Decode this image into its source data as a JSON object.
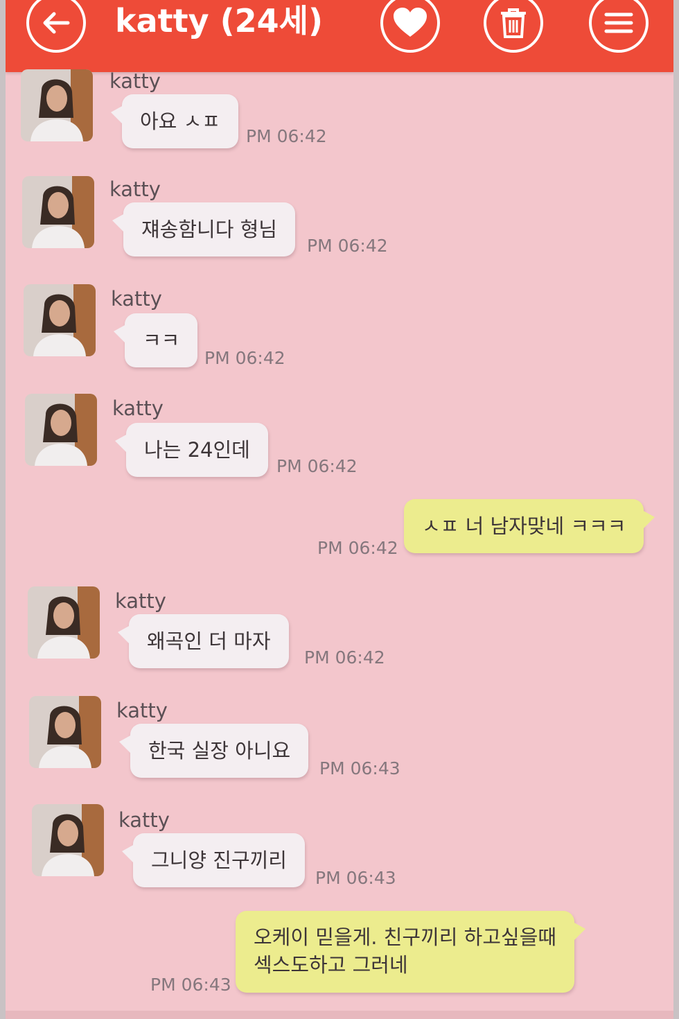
{
  "header": {
    "title": "katty (24세)",
    "icons": [
      "back-arrow-icon",
      "heart-icon",
      "trash-icon",
      "menu-icon"
    ],
    "bar_color": "#ee4b38"
  },
  "chat": {
    "background": "#f3c6cc",
    "incoming_bubble_color": "#f4eef1",
    "outgoing_bubble_color": "#ecec8e",
    "messages": [
      {
        "direction": "in",
        "sender": "katty",
        "text": "아요 ㅅㅍ",
        "time": "PM 06:42"
      },
      {
        "direction": "in",
        "sender": "katty",
        "text": "쟤송함니다 형님",
        "time": "PM 06:42"
      },
      {
        "direction": "in",
        "sender": "katty",
        "text": "ㅋㅋ",
        "time": "PM 06:42"
      },
      {
        "direction": "in",
        "sender": "katty",
        "text": "나는 24인데",
        "time": "PM 06:42"
      },
      {
        "direction": "out",
        "text": "ㅅㅍ 너 남자맞네 ㅋㅋㅋ",
        "time": "PM 06:42"
      },
      {
        "direction": "in",
        "sender": "katty",
        "text": "왜곡인 더  마자",
        "time": "PM 06:42"
      },
      {
        "direction": "in",
        "sender": "katty",
        "text": "한국 실장 아니요",
        "time": "PM 06:43"
      },
      {
        "direction": "in",
        "sender": "katty",
        "text": "그니양 진구끼리",
        "time": "PM 06:43"
      },
      {
        "direction": "out",
        "text": "오케이 믿을게. 친구끼리 하고싶을때\n섹스도하고 그러네",
        "time": "PM 06:43"
      }
    ]
  }
}
